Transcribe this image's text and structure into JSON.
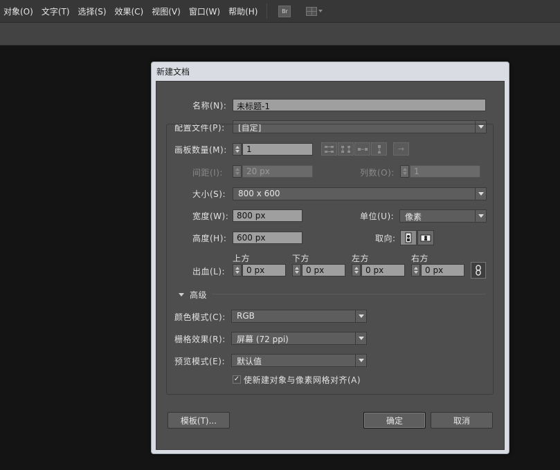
{
  "menu": [
    "对象(O)",
    "文字(T)",
    "选择(S)",
    "效果(C)",
    "视图(V)",
    "窗口(W)",
    "帮助(H)"
  ],
  "toolbar": {
    "bridge_badge": "Br"
  },
  "dialog": {
    "title": "新建文档",
    "name_label": "名称(N):",
    "name_value": "未标题-1",
    "profile_label": "配置文件(P):",
    "profile_value": "[自定]",
    "artboards_label": "画板数量(M):",
    "artboards_value": "1",
    "arrow_glyph": "→",
    "spacing_label": "间距(I):",
    "spacing_value": "20 px",
    "columns_label": "列数(O):",
    "columns_value": "1",
    "size_label": "大小(S):",
    "size_value": "800 x 600",
    "width_label": "宽度(W):",
    "width_value": "800 px",
    "units_label": "单位(U):",
    "units_value": "像素",
    "height_label": "高度(H):",
    "height_value": "600 px",
    "orientation_label": "取向:",
    "bleed_label": "出血(L):",
    "bleed_top_label": "上方",
    "bleed_top_value": "0 px",
    "bleed_bottom_label": "下方",
    "bleed_bottom_value": "0 px",
    "bleed_left_label": "左方",
    "bleed_left_value": "0 px",
    "bleed_right_label": "右方",
    "bleed_right_value": "0 px",
    "advanced_label": "高级",
    "color_mode_label": "颜色模式(C):",
    "color_mode_value": "RGB",
    "raster_label": "栅格效果(R):",
    "raster_value": "屏幕 (72 ppi)",
    "preview_label": "预览模式(E):",
    "preview_value": "默认值",
    "align_pixel_label": "使新建对象与像素网格对齐(A)",
    "align_pixel_checked": true,
    "check_glyph": "✓",
    "templates_button": "模板(T)...",
    "ok_button": "确定",
    "cancel_button": "取消"
  },
  "colors": {
    "menubar": "#373737",
    "dialog_body": "#4e4e4e",
    "dialog_frame": "#d9dde3"
  }
}
